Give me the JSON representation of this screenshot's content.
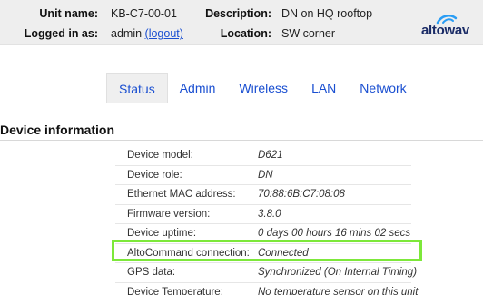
{
  "header": {
    "unit_name_label": "Unit name:",
    "unit_name": "KB-C7-00-01",
    "description_label": "Description:",
    "description": "DN on HQ rooftop",
    "logged_in_label": "Logged in as:",
    "user": "admin",
    "logout_label": "(logout)",
    "location_label": "Location:",
    "location": "SW corner",
    "logo_text": "altowav"
  },
  "tabs": [
    "Status",
    "Admin",
    "Wireless",
    "LAN",
    "Network"
  ],
  "active_tab": "Status",
  "section_title": "Device information",
  "device_info": [
    {
      "label": "Device model:",
      "value": "D621"
    },
    {
      "label": "Device role:",
      "value": "DN"
    },
    {
      "label": "Ethernet MAC address:",
      "value": "70:88:6B:C7:08:08"
    },
    {
      "label": "Firmware version:",
      "value": "3.8.0"
    },
    {
      "label": "Device uptime:",
      "value": "0 days 00 hours 16 mins 02 secs"
    },
    {
      "label": "AltoCommand connection:",
      "value": "Connected"
    },
    {
      "label": "GPS data:",
      "value": "Synchronized (On Internal Timing)"
    },
    {
      "label": "Device Temperature:",
      "value": "No temperature sensor on this unit"
    }
  ],
  "colors": {
    "link": "#1a4fd1",
    "highlight": "#7de83a",
    "header_bg": "#eeeeee"
  }
}
